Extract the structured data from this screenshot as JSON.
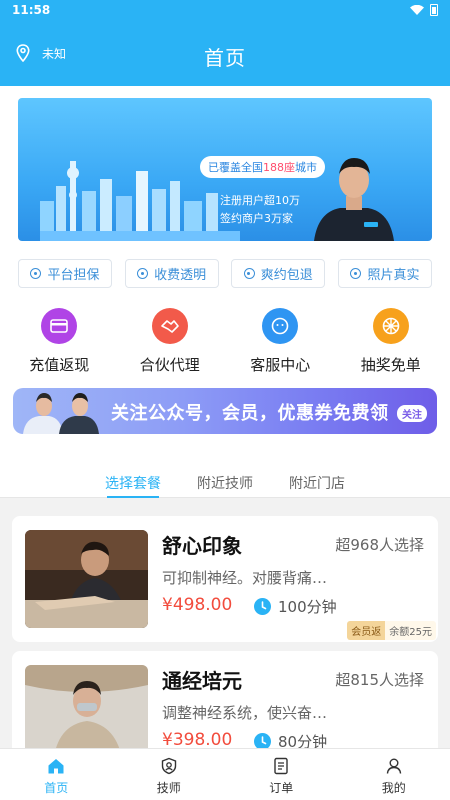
{
  "status_bar": {
    "time": "11:58"
  },
  "header": {
    "location": "未知",
    "title": "首页"
  },
  "banner": {
    "pill_prefix": "已覆盖全国",
    "pill_highlight": "188座",
    "pill_suffix": "城市",
    "line1": "注册用户超10万",
    "line2": "签约商户3万家"
  },
  "guarantees": [
    {
      "label": "平台担保"
    },
    {
      "label": "收费透明"
    },
    {
      "label": "爽约包退"
    },
    {
      "label": "照片真实"
    }
  ],
  "features": [
    {
      "label": "充值返现",
      "color": "#b044e6"
    },
    {
      "label": "合伙代理",
      "color": "#f25a4a"
    },
    {
      "label": "客服中心",
      "color": "#2f95f2"
    },
    {
      "label": "抽奖免单",
      "color": "#f7a11c"
    }
  ],
  "promo": {
    "text": "关注公众号，会员，优惠券免费领",
    "button": "关注"
  },
  "tabs": [
    {
      "label": "选择套餐"
    },
    {
      "label": "附近技师"
    },
    {
      "label": "附近门店"
    }
  ],
  "packages": [
    {
      "title": "舒心印象",
      "count": "超968人选择",
      "desc": "可抑制神经。对腰背痛…",
      "price": "¥498.00",
      "duration": "100分钟",
      "member_tag": "会员返",
      "member_value": "余额25元"
    },
    {
      "title": "通经培元",
      "count": "超815人选择",
      "desc": "调整神经系统，使兴奋…",
      "price": "¥398.00",
      "duration": "80分钟"
    }
  ],
  "bottom_nav": [
    {
      "label": "首页"
    },
    {
      "label": "技师"
    },
    {
      "label": "订单"
    },
    {
      "label": "我的"
    }
  ],
  "colors": {
    "primary": "#2ab3f5",
    "price": "#f24c3d"
  }
}
